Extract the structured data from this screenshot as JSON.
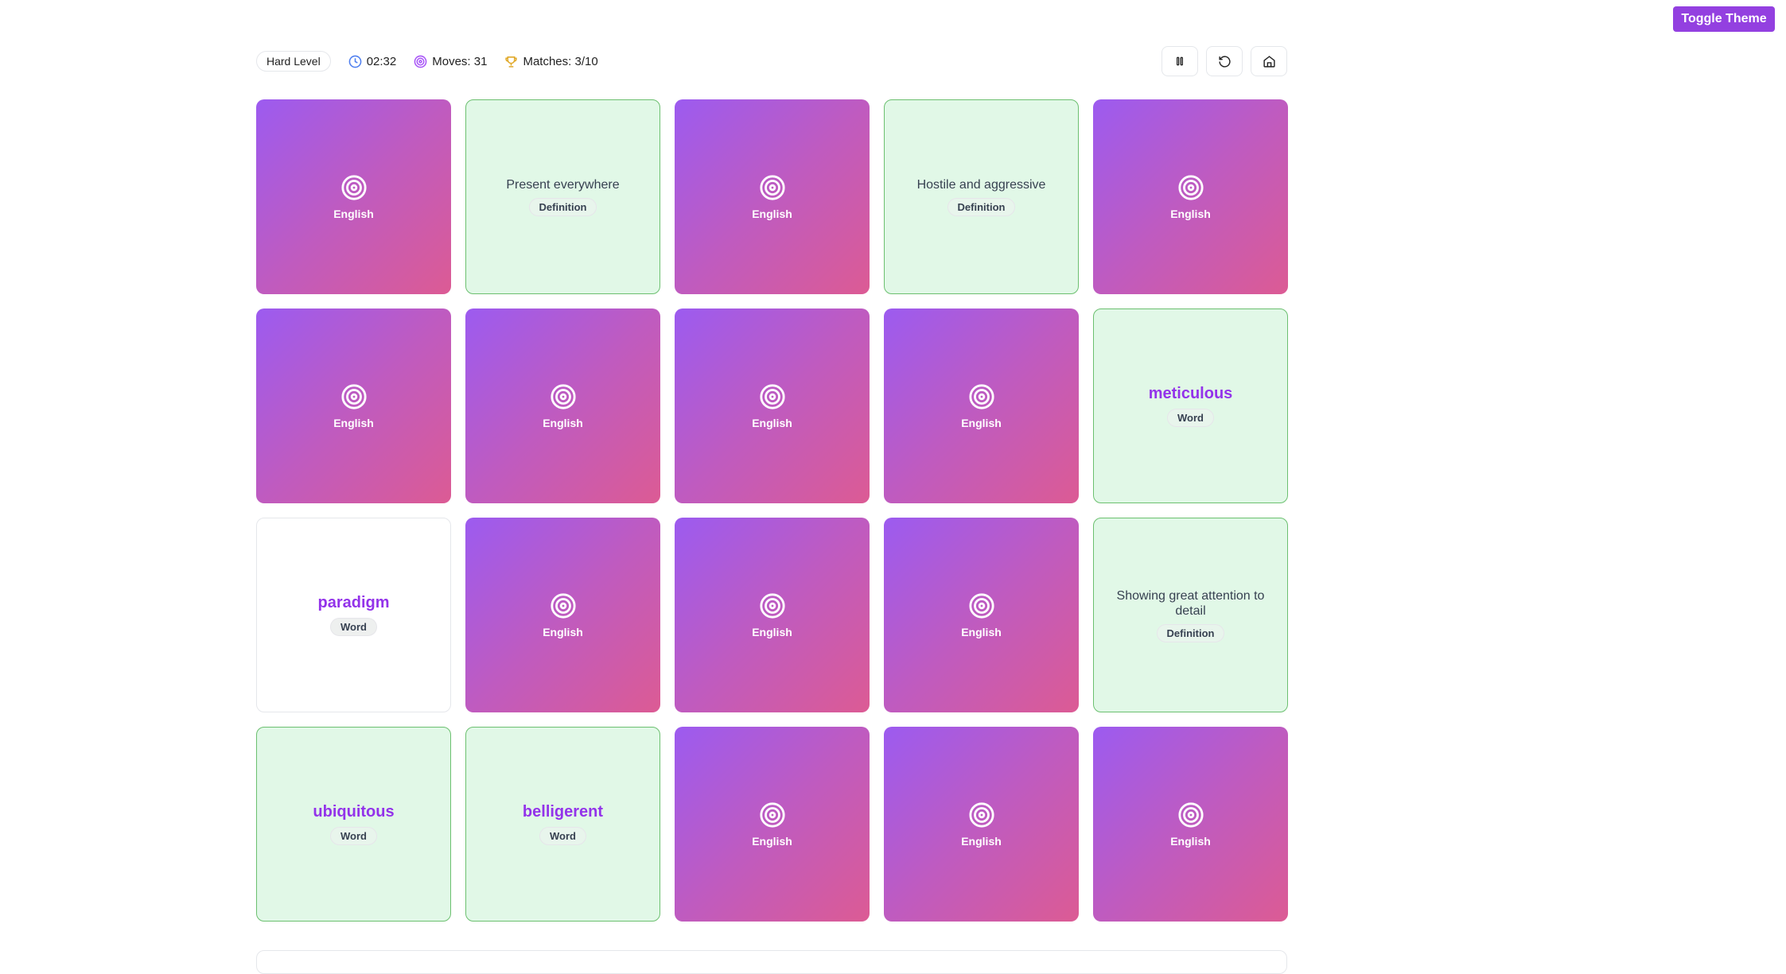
{
  "header": {
    "toggle_theme": "Toggle Theme",
    "level": "Hard Level",
    "timer": "02:32",
    "moves": "Moves: 31",
    "matches": "Matches: 3/10"
  },
  "colors": {
    "accent": "#9340e0",
    "card_back_start": "#9c5bf0",
    "card_back_end": "#dc5b94",
    "matched_bg": "#e1f8e7",
    "matched_border": "#6cc070",
    "word": "#9333ea"
  },
  "controls": [
    {
      "icon": "pause-icon"
    },
    {
      "icon": "restart-icon"
    },
    {
      "icon": "home-icon"
    }
  ],
  "cards": [
    {
      "state": "hidden",
      "label": "English"
    },
    {
      "state": "matched",
      "text": "Present everywhere",
      "type": "Definition"
    },
    {
      "state": "hidden",
      "label": "English"
    },
    {
      "state": "matched",
      "text": "Hostile and aggressive",
      "type": "Definition"
    },
    {
      "state": "hidden",
      "label": "English"
    },
    {
      "state": "hidden",
      "label": "English"
    },
    {
      "state": "hidden",
      "label": "English"
    },
    {
      "state": "hidden",
      "label": "English"
    },
    {
      "state": "hidden",
      "label": "English"
    },
    {
      "state": "matched",
      "text": "meticulous",
      "type": "Word"
    },
    {
      "state": "open",
      "text": "paradigm",
      "type": "Word"
    },
    {
      "state": "hidden",
      "label": "English"
    },
    {
      "state": "hidden",
      "label": "English"
    },
    {
      "state": "hidden",
      "label": "English"
    },
    {
      "state": "matched",
      "text": "Showing great attention to detail",
      "type": "Definition"
    },
    {
      "state": "matched",
      "text": "ubiquitous",
      "type": "Word"
    },
    {
      "state": "matched",
      "text": "belligerent",
      "type": "Word"
    },
    {
      "state": "hidden",
      "label": "English"
    },
    {
      "state": "hidden",
      "label": "English"
    },
    {
      "state": "hidden",
      "label": "English"
    }
  ]
}
